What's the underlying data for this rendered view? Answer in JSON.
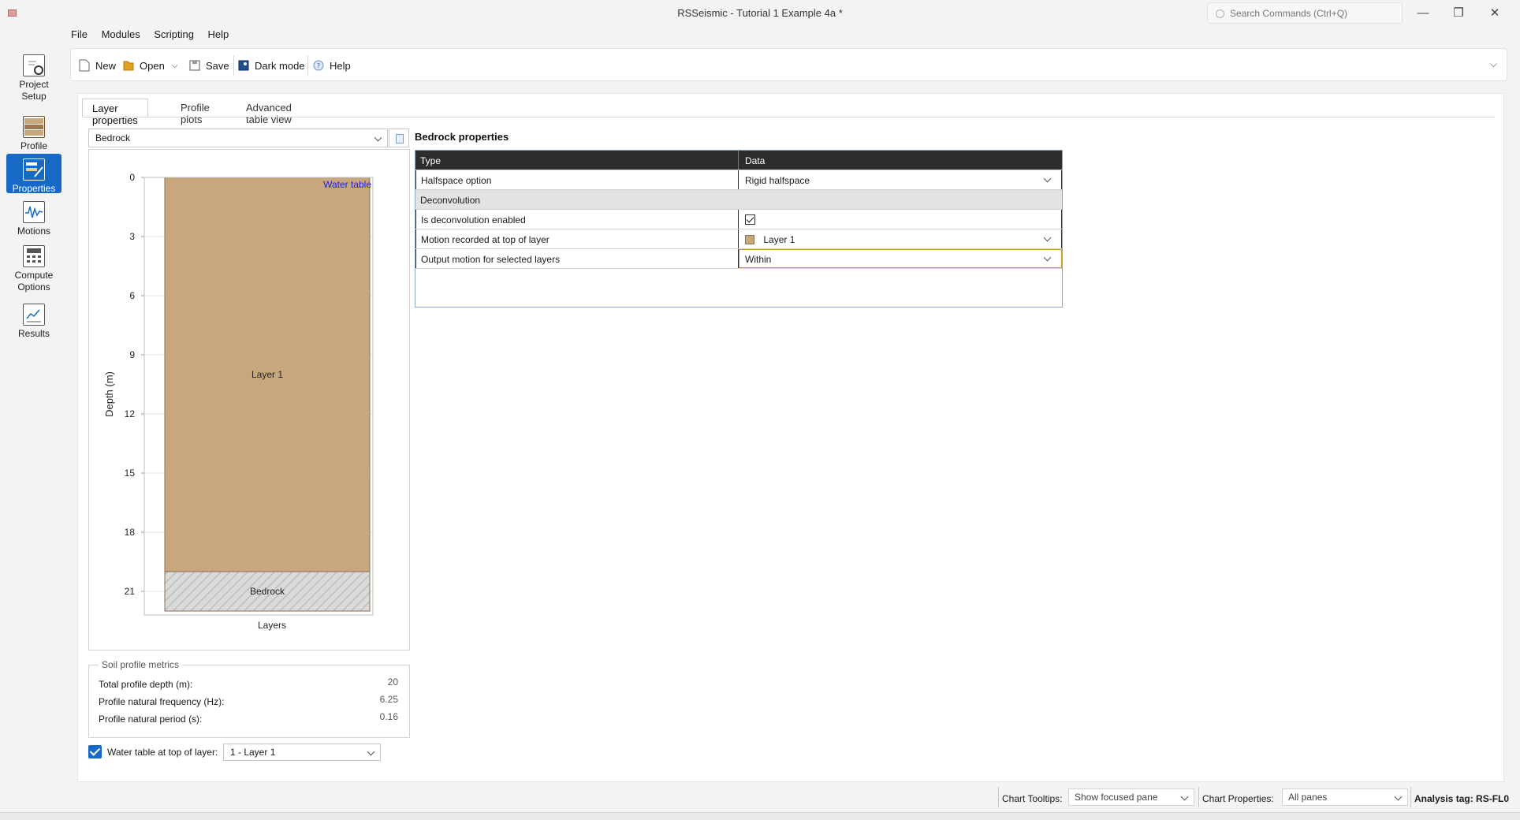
{
  "window": {
    "title": "RSSeismic - Tutorial 1 Example 4a *",
    "search_placeholder": "Search Commands (Ctrl+Q)",
    "minimize": "—",
    "restore": "❐",
    "close": "✕"
  },
  "sidebar": {
    "items": [
      {
        "label": "Project Setup",
        "icon": "project-setup-icon"
      },
      {
        "label": "Profile",
        "icon": "profile-icon"
      },
      {
        "label": "Properties",
        "icon": "properties-icon",
        "active": true
      },
      {
        "label": "Motions",
        "icon": "motions-icon"
      },
      {
        "label": "Compute Options",
        "icon": "compute-options-icon"
      },
      {
        "label": "Results",
        "icon": "results-icon"
      }
    ]
  },
  "menu": [
    "File",
    "Modules",
    "Scripting",
    "Help"
  ],
  "toolbar": {
    "new": "New",
    "open": "Open",
    "save": "Save",
    "dark_mode": "Dark mode",
    "help": "Help"
  },
  "tabs": [
    "Layer properties",
    "Profile plots",
    "Advanced table view"
  ],
  "layer_select": {
    "value": "Bedrock"
  },
  "chart_data": {
    "type": "bar",
    "ylabel": "Depth (m)",
    "xlabel": "Layers",
    "ylim": [
      0,
      22
    ],
    "yticks": [
      0,
      3,
      6,
      9,
      12,
      15,
      18,
      21
    ],
    "inverted_y": true,
    "grid": true,
    "layers": [
      {
        "name": "Layer 1",
        "top": 0,
        "bottom": 20,
        "color": "#c9a77c"
      },
      {
        "name": "Bedrock",
        "top": 20,
        "bottom": 22,
        "color": "#d4d4d4",
        "hatched": true
      }
    ],
    "annotations": [
      {
        "text": "Water table",
        "depth": 0,
        "color": "#2222cc"
      }
    ]
  },
  "metrics": {
    "title": "Soil profile metrics",
    "rows": [
      {
        "label": "Total profile depth (m):",
        "value": "20"
      },
      {
        "label": "Profile natural frequency (Hz):",
        "value": "6.25"
      },
      {
        "label": "Profile natural period (s):",
        "value": "0.16"
      }
    ]
  },
  "water_table": {
    "label": "Water table at top of layer:",
    "checked": true,
    "value": "1 - Layer 1"
  },
  "properties": {
    "title": "Bedrock properties",
    "header": {
      "type": "Type",
      "data": "Data"
    },
    "rows": [
      {
        "type": "Halfspace option",
        "data": "Rigid halfspace",
        "kind": "dropdown"
      },
      {
        "type": "Deconvolution",
        "kind": "group"
      },
      {
        "type": "Is deconvolution enabled",
        "kind": "checkbox",
        "checked": true
      },
      {
        "type": "Motion recorded at top of layer",
        "data": "Layer 1",
        "kind": "dropdown-swatch"
      },
      {
        "type": "Output motion for selected layers",
        "data": "Within",
        "kind": "dropdown"
      }
    ]
  },
  "statusbar": {
    "chart_tooltips_label": "Chart Tooltips:",
    "chart_tooltips_value": "Show focused pane",
    "chart_properties_label": "Chart Properties:",
    "chart_properties_value": "All panes",
    "analysis_tag": "Analysis tag: RS-FL0"
  },
  "colors": {
    "accent": "#1669c4",
    "soil": "#c9a77c",
    "header": "#2d2d2d"
  }
}
